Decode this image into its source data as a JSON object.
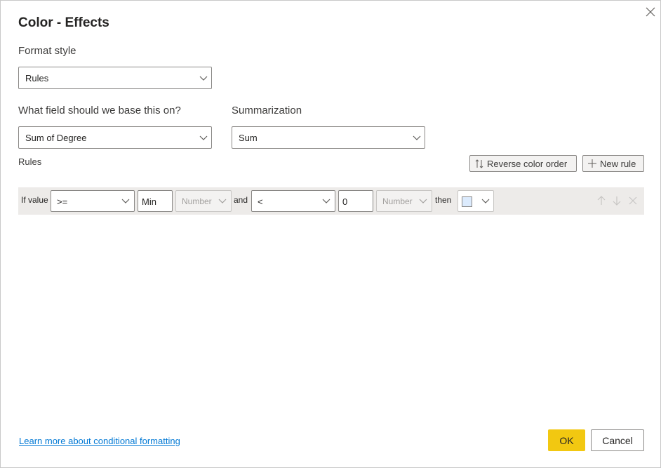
{
  "dialog": {
    "title": "Color - Effects",
    "close_icon": "close-icon"
  },
  "format_style": {
    "label": "Format style",
    "value": "Rules"
  },
  "field": {
    "label": "What field should we base this on?",
    "value": "Sum of Degree"
  },
  "summarization": {
    "label": "Summarization",
    "value": "Sum"
  },
  "rules": {
    "label": "Rules",
    "reverse_label": "Reverse color order",
    "reverse_icon": "sort-arrows-icon",
    "new_rule_label": "New rule",
    "new_rule_icon": "plus-icon",
    "items": [
      {
        "if_value_label": "If value",
        "operator1": ">=",
        "value1": "Min",
        "type1": "Number",
        "and_label": "and",
        "operator2": "<",
        "value2": "0",
        "type2": "Number",
        "then_label": "then",
        "color": "#dcebfd"
      }
    ]
  },
  "footer": {
    "link_label": "Learn more about conditional formatting",
    "ok_label": "OK",
    "cancel_label": "Cancel"
  },
  "colors": {
    "accent_ok": "#f2c811",
    "link": "#0078d4"
  }
}
